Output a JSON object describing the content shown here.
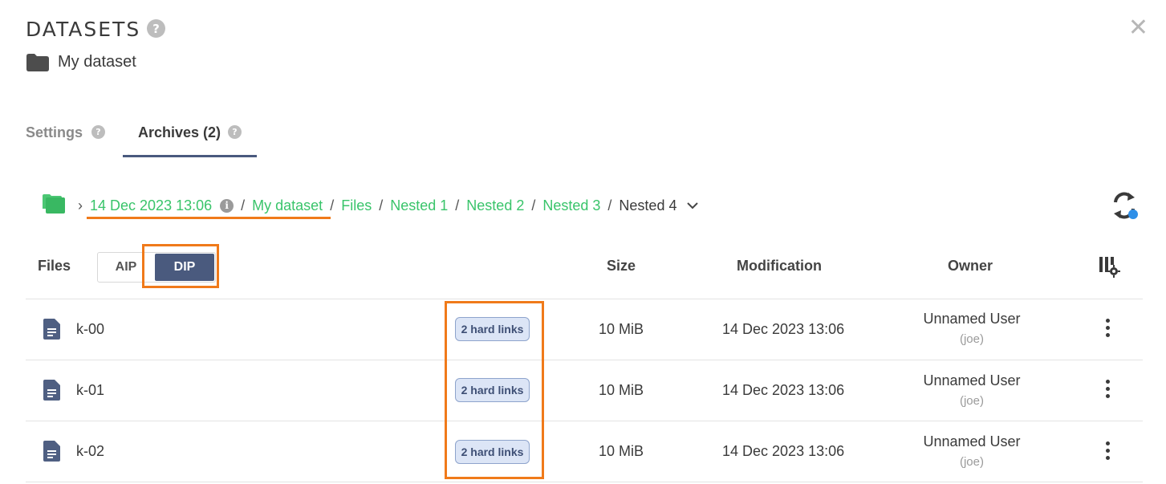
{
  "header": {
    "title": "DATASETS",
    "help": "?",
    "close": "✕",
    "dataset_name": "My dataset"
  },
  "tabs": [
    {
      "label": "Settings",
      "help": "?"
    },
    {
      "label": "Archives (2)",
      "help": "?"
    }
  ],
  "breadcrumb": {
    "chevron": "›",
    "items": [
      "14 Dec 2023 13:06",
      "My dataset",
      "Files",
      "Nested 1",
      "Nested 2",
      "Nested 3",
      "Nested 4"
    ],
    "info": "i",
    "separator": "/"
  },
  "table": {
    "columns": {
      "files": "Files",
      "size": "Size",
      "modification": "Modification",
      "owner": "Owner"
    },
    "toggle": {
      "aip": "AIP",
      "dip": "DIP",
      "selected": "DIP"
    },
    "rows": [
      {
        "name": "k-00",
        "badge": "2 hard links",
        "size": "10 MiB",
        "modified": "14 Dec 2023 13:06",
        "owner": "Unnamed User",
        "login": "(joe)"
      },
      {
        "name": "k-01",
        "badge": "2 hard links",
        "size": "10 MiB",
        "modified": "14 Dec 2023 13:06",
        "owner": "Unnamed User",
        "login": "(joe)"
      },
      {
        "name": "k-02",
        "badge": "2 hard links",
        "size": "10 MiB",
        "modified": "14 Dec 2023 13:06",
        "owner": "Unnamed User",
        "login": "(joe)"
      }
    ]
  },
  "colors": {
    "accent": "#4a5a7e",
    "link": "#39c46a",
    "annotation": "#f07a1a",
    "badge_bg": "#dce5f6",
    "refresh_dot": "#2e8fe8"
  },
  "icons": [
    "help-icon",
    "close-icon",
    "folder-icon",
    "folder-green-icon",
    "info-icon",
    "chevron-down-icon",
    "refresh-icon",
    "columns-settings-icon",
    "file-icon",
    "kebab-icon"
  ]
}
